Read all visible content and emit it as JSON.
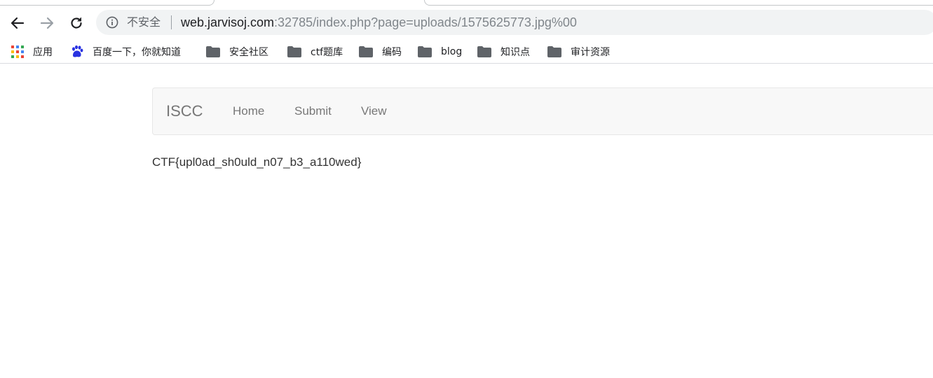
{
  "browser": {
    "address_bar": {
      "security_label": "不安全",
      "url_host": "web.jarvisoj.com",
      "url_rest": ":32785/index.php?page=uploads/1575625773.jpg%00"
    },
    "bookmarks": [
      {
        "label": "应用",
        "icon": "apps-grid-icon"
      },
      {
        "label": "百度一下，你就知道",
        "icon": "baidu-paw-icon"
      },
      {
        "label": "安全社区",
        "icon": "folder-icon"
      },
      {
        "label": "ctf题库",
        "icon": "folder-icon"
      },
      {
        "label": "编码",
        "icon": "folder-icon"
      },
      {
        "label": "blog",
        "icon": "folder-icon"
      },
      {
        "label": "知识点",
        "icon": "folder-icon"
      },
      {
        "label": "审计资源",
        "icon": "folder-icon"
      }
    ]
  },
  "page": {
    "navbar": {
      "brand": "ISCC",
      "links": [
        "Home",
        "Submit",
        "View"
      ]
    },
    "flag_text": "CTF{upl0ad_sh0uld_n07_b3_a110wed}"
  },
  "colors": {
    "navbar_bg": "#f8f8f8",
    "navbar_link": "#777777",
    "omnibox_bg": "#f1f3f4",
    "text": "#333333"
  }
}
